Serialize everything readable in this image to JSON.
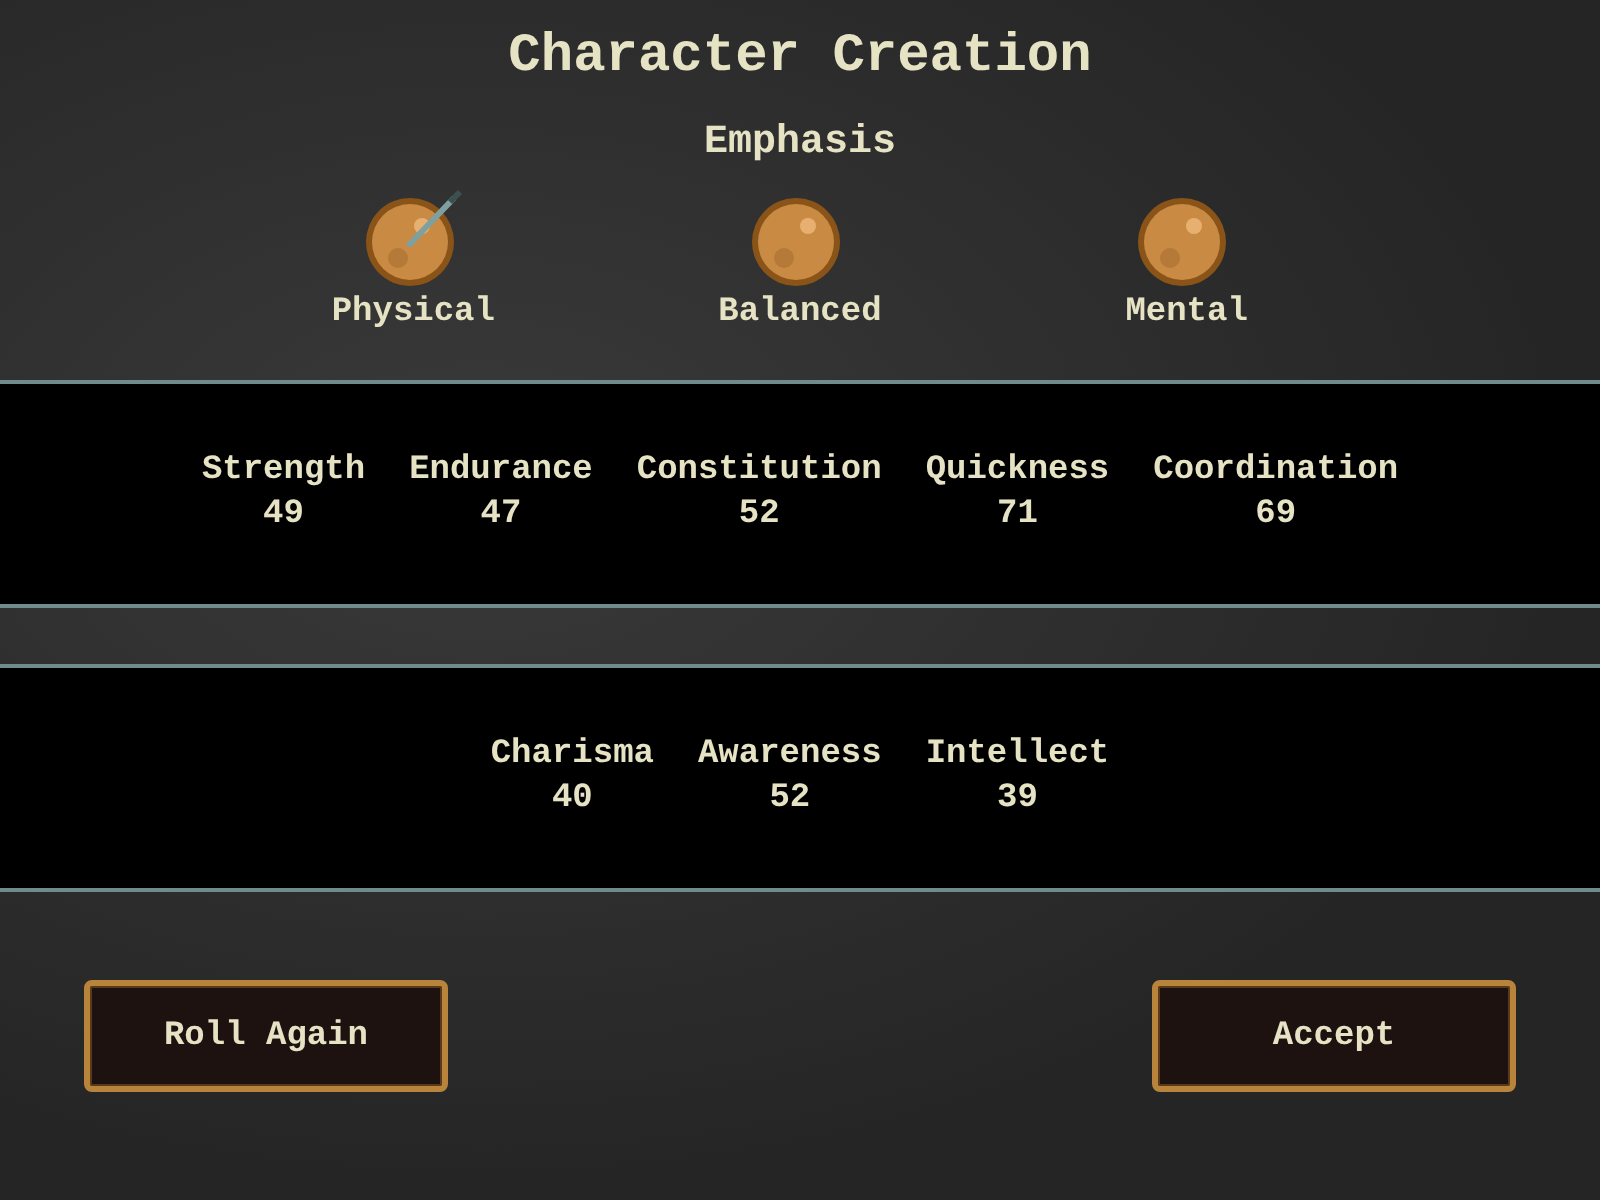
{
  "title": "Character Creation",
  "emphasis": {
    "heading": "Emphasis",
    "options": [
      {
        "label": "Physical",
        "selected": true
      },
      {
        "label": "Balanced",
        "selected": false
      },
      {
        "label": "Mental",
        "selected": false
      }
    ]
  },
  "stat_panels": [
    {
      "stats": [
        {
          "name": "Strength",
          "value": "49"
        },
        {
          "name": "Endurance",
          "value": "47"
        },
        {
          "name": "Constitution",
          "value": "52"
        },
        {
          "name": "Quickness",
          "value": "71"
        },
        {
          "name": "Coordination",
          "value": "69"
        }
      ]
    },
    {
      "stats": [
        {
          "name": "Charisma",
          "value": "40"
        },
        {
          "name": "Awareness",
          "value": "52"
        },
        {
          "name": "Intellect",
          "value": "39"
        }
      ]
    }
  ],
  "buttons": [
    {
      "label": "Roll Again"
    },
    {
      "label": "Accept"
    }
  ]
}
